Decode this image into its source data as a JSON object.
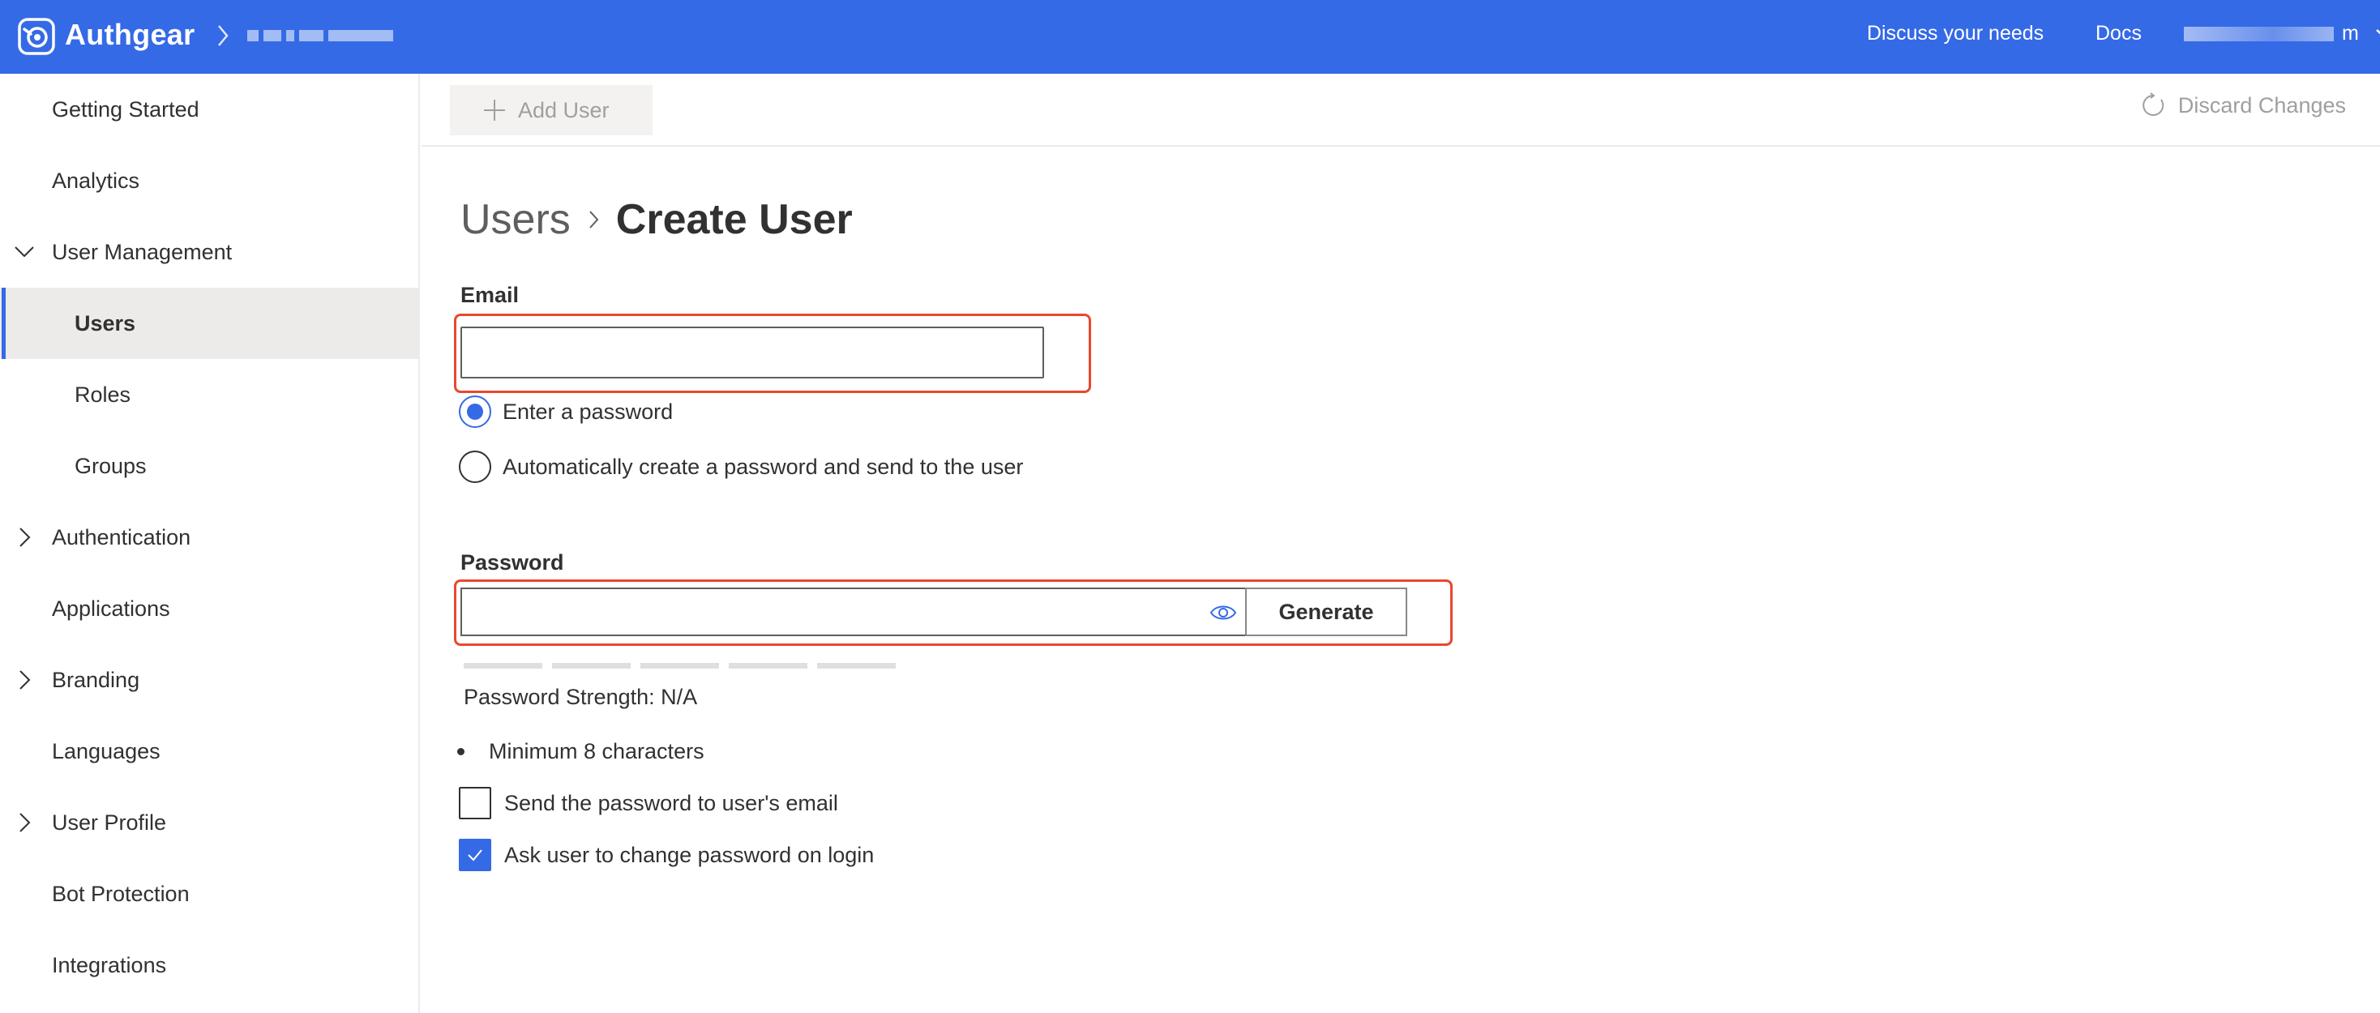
{
  "header": {
    "brand": "Authgear",
    "project_chevron": "chevron-right-icon",
    "links": {
      "discuss": "Discuss your needs",
      "docs": "Docs"
    },
    "account_suffix": "m",
    "account_chevron": "chevron-down-icon",
    "background_color": "#356ae6"
  },
  "sidebar": {
    "items": [
      {
        "label": "Getting Started"
      },
      {
        "label": "Analytics"
      },
      {
        "label": "User Management",
        "expanded": true
      },
      {
        "label": "Users",
        "selected": true
      },
      {
        "label": "Roles"
      },
      {
        "label": "Groups"
      },
      {
        "label": "Authentication",
        "expandable": true
      },
      {
        "label": "Applications"
      },
      {
        "label": "Branding",
        "expandable": true
      },
      {
        "label": "Languages"
      },
      {
        "label": "User Profile",
        "expandable": true
      },
      {
        "label": "Bot Protection"
      },
      {
        "label": "Integrations"
      }
    ]
  },
  "commandbar": {
    "add_user": "Add User",
    "discard_changes": "Discard Changes"
  },
  "breadcrumb": {
    "parent": "Users",
    "current": "Create User"
  },
  "form": {
    "email_label": "Email",
    "email_value": "",
    "radio_enter_password": "Enter a password",
    "radio_auto_password": "Automatically create a password and send to the user",
    "selected_radio": "enter_password",
    "password_label": "Password",
    "password_value": "",
    "generate": "Generate",
    "strength": "Password Strength: N/A",
    "rule_min_length": "Minimum 8 characters",
    "send_password_email": "Send the password to user's email",
    "send_password_email_checked": false,
    "change_on_login": "Ask user to change password on login",
    "change_on_login_checked": true
  },
  "colors": {
    "accent": "#356ae6",
    "highlight": "#e8492d",
    "disabled_text": "#a19f9d"
  }
}
